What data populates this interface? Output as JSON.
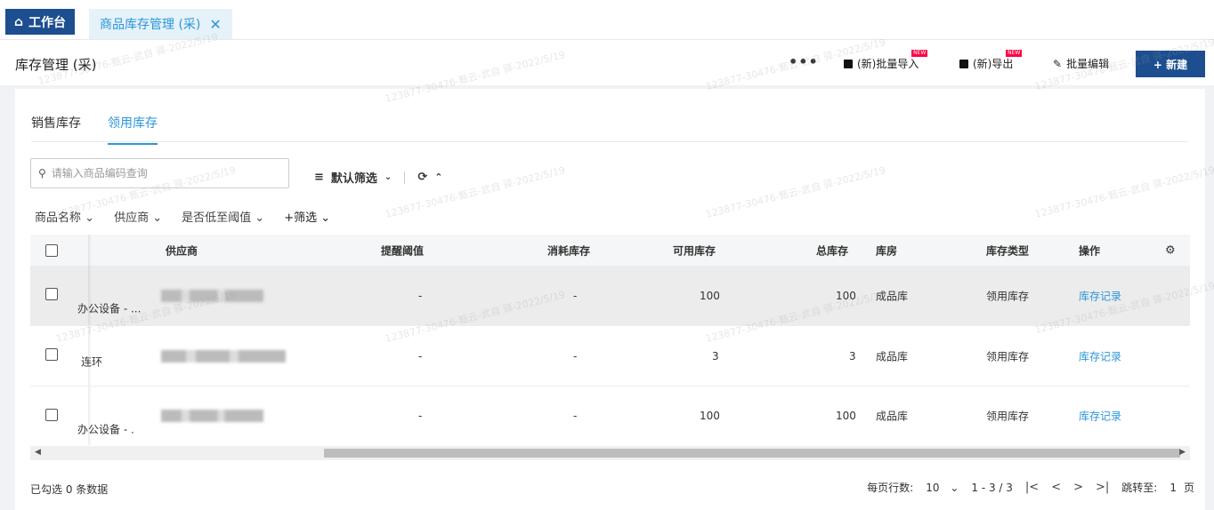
{
  "tabs": {
    "home_label": "工作台",
    "active_label": "商品库存管理 (采)"
  },
  "header": {
    "title": "库存管理 (采)",
    "more_label": "•••",
    "batch_import_label": "(新)批量导入",
    "export_label": "(新)导出",
    "new_badge": "NEW",
    "batch_edit_label": "批量编辑",
    "new_button_label": "+ 新建"
  },
  "subtabs": [
    "销售库存",
    "领用库存"
  ],
  "search": {
    "placeholder": "请输入商品编码查询"
  },
  "filter_controls": {
    "default_filter_label": "默认筛选"
  },
  "filters": [
    "商品名称",
    "供应商",
    "是否低至阈值",
    "+筛选"
  ],
  "table": {
    "columns": [
      "供应商",
      "提醒阈值",
      "消耗库存",
      "可用库存",
      "总库存",
      "库房",
      "库存类型",
      "操作"
    ],
    "rows": [
      {
        "name": "办公设备 - ...",
        "threshold": "-",
        "consumed": "-",
        "available": "100",
        "total": "100",
        "warehouse": "成品库",
        "stock_type": "领用库存",
        "action": "库存记录"
      },
      {
        "name": "连环",
        "threshold": "-",
        "consumed": "-",
        "available": "3",
        "total": "3",
        "warehouse": "成品库",
        "stock_type": "领用库存",
        "action": "库存记录"
      },
      {
        "name": "办公设备 - .",
        "threshold": "-",
        "consumed": "-",
        "available": "100",
        "total": "100",
        "warehouse": "成品库",
        "stock_type": "领用库存",
        "action": "库存记录"
      }
    ]
  },
  "footer": {
    "selected_info": "已勾选 0 条数据",
    "rows_per_page_label": "每页行数:",
    "rows_per_page": "10",
    "range": "1 - 3 / 3",
    "jump_label": "跳转至:",
    "jump_page": "1",
    "page_unit": "页"
  },
  "watermark": "123877-30476-甄云-武自\n驿-2022/5/19",
  "colors": {
    "primary": "#1d4e8f",
    "link": "#2a96d9",
    "new_badge": "#ff0044"
  }
}
